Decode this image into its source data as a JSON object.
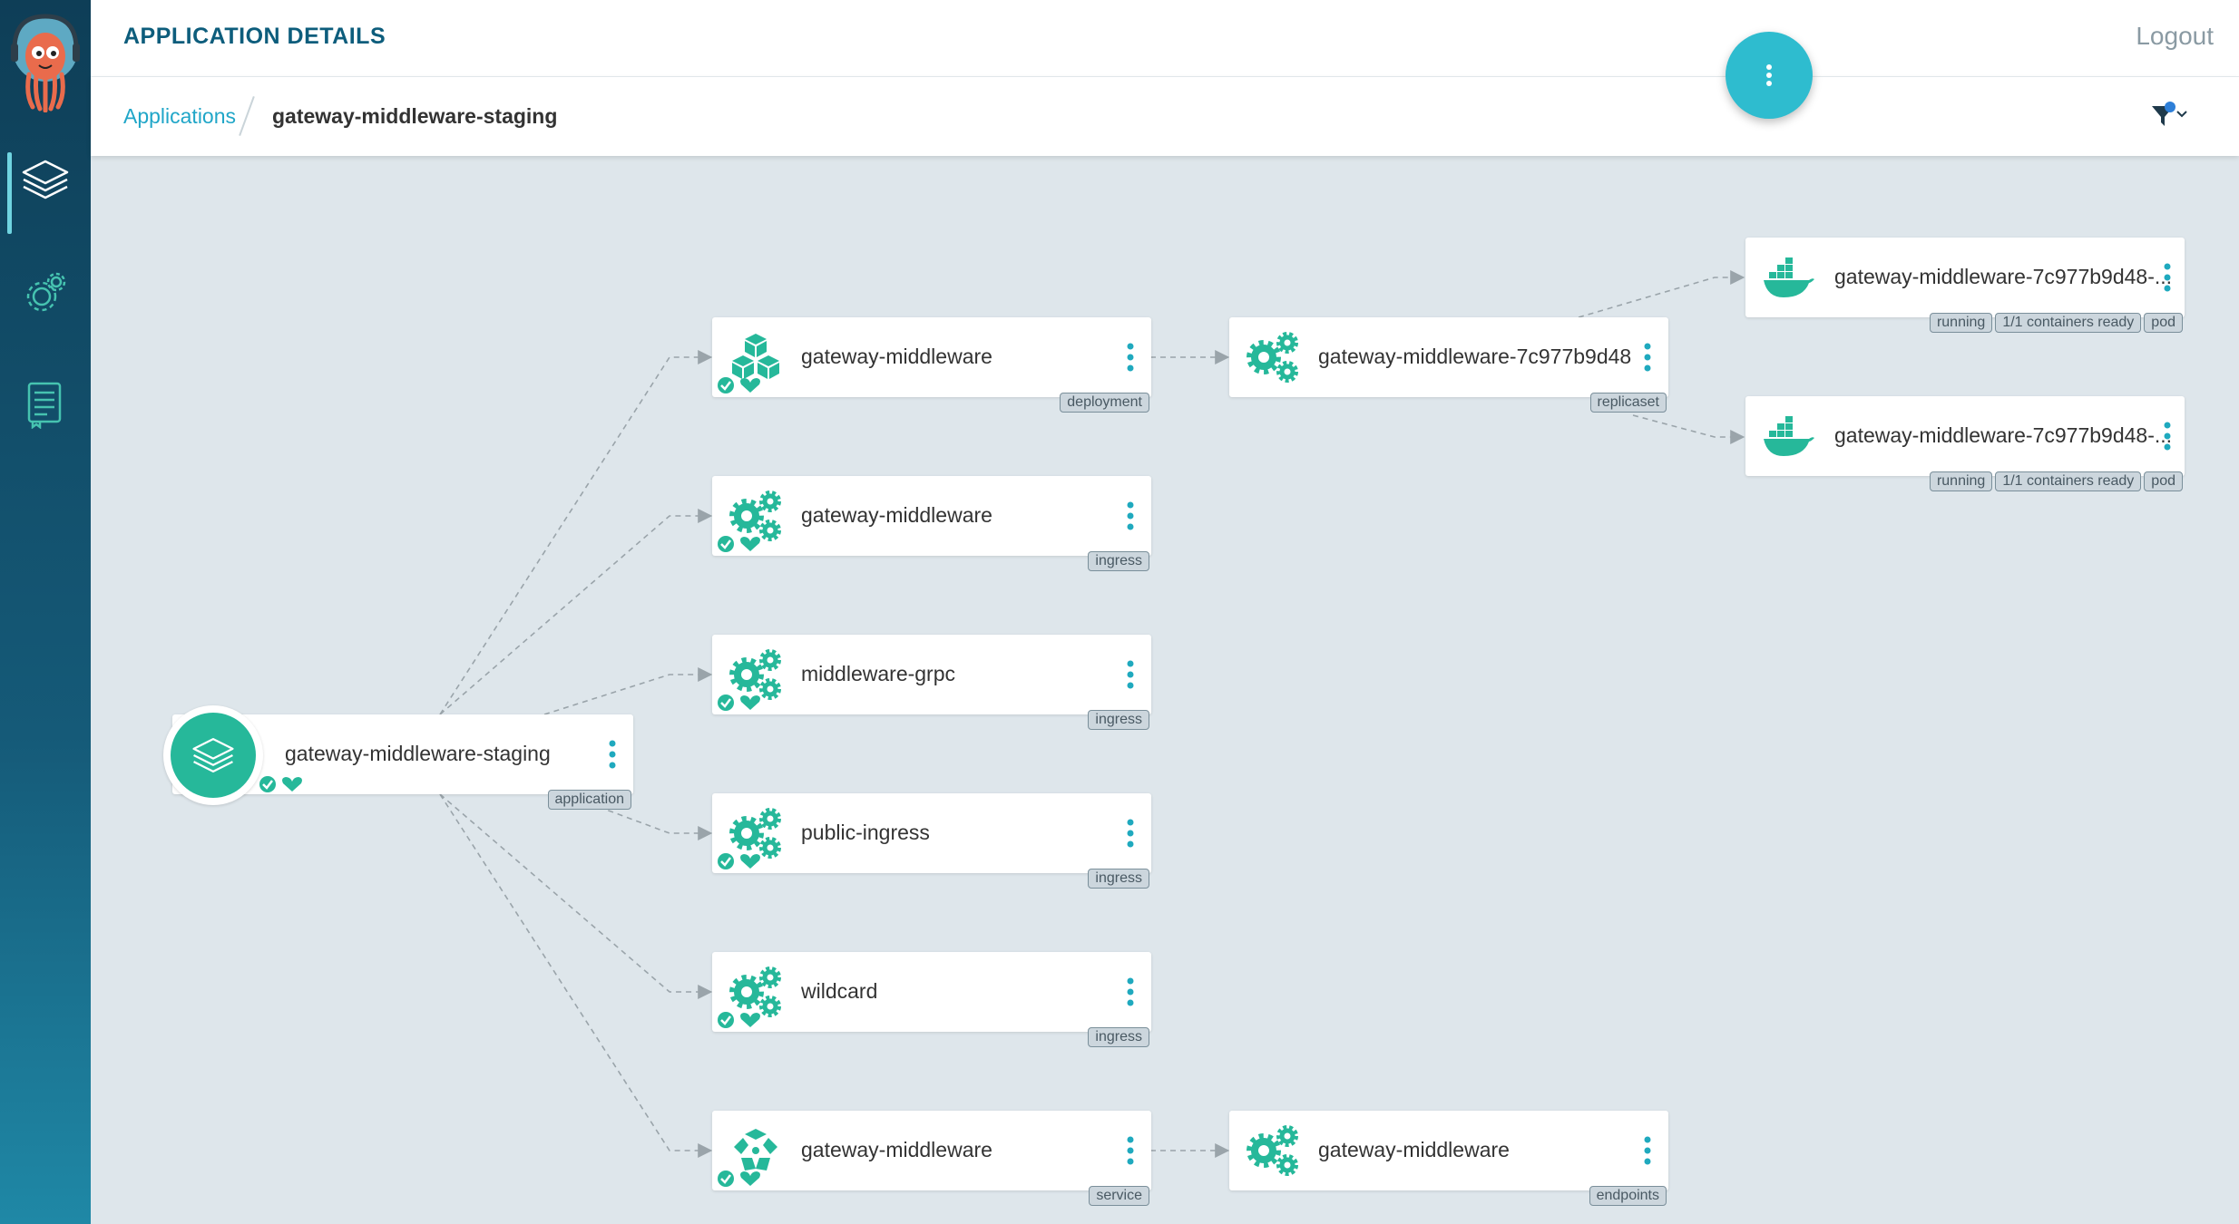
{
  "header": {
    "title": "APPLICATION DETAILS",
    "logout": "Logout"
  },
  "breadcrumb": {
    "parent": "Applications",
    "current": "gateway-middleware-staging"
  },
  "colors": {
    "accent": "#2ebccf",
    "healthy": "#26b89a",
    "title": "#0d5d7c",
    "link": "#20a6c8"
  },
  "app": {
    "name": "gateway-middleware-staging",
    "tag": "application",
    "icon": "layers-icon",
    "sync_status": "synced",
    "health": "healthy"
  },
  "resources": [
    {
      "name": "gateway-middleware",
      "kind": "deployment",
      "icon": "deployment-cubes-icon",
      "sync_status": "synced",
      "health": "healthy"
    },
    {
      "name": "gateway-middleware",
      "kind": "ingress",
      "icon": "gears-icon",
      "sync_status": "synced",
      "health": "healthy"
    },
    {
      "name": "middleware-grpc",
      "kind": "ingress",
      "icon": "gears-icon",
      "sync_status": "synced",
      "health": "healthy"
    },
    {
      "name": "public-ingress",
      "kind": "ingress",
      "icon": "gears-icon",
      "sync_status": "synced",
      "health": "healthy"
    },
    {
      "name": "wildcard",
      "kind": "ingress",
      "icon": "gears-icon",
      "sync_status": "synced",
      "health": "healthy"
    },
    {
      "name": "gateway-middleware",
      "kind": "service",
      "icon": "service-icon",
      "sync_status": "synced",
      "health": "healthy"
    }
  ],
  "children": [
    {
      "name": "gateway-middleware-7c977b9d48",
      "kind": "replicaset",
      "icon": "gears-icon"
    },
    {
      "name": "gateway-middleware",
      "kind": "endpoints",
      "icon": "gears-icon"
    }
  ],
  "pods": [
    {
      "name": "gateway-middleware-7c977b9d48-...",
      "tags": [
        "running",
        "1/1 containers ready",
        "pod"
      ],
      "icon": "docker-icon"
    },
    {
      "name": "gateway-middleware-7c977b9d48-...",
      "tags": [
        "running",
        "1/1 containers ready",
        "pod"
      ],
      "icon": "docker-icon"
    }
  ]
}
